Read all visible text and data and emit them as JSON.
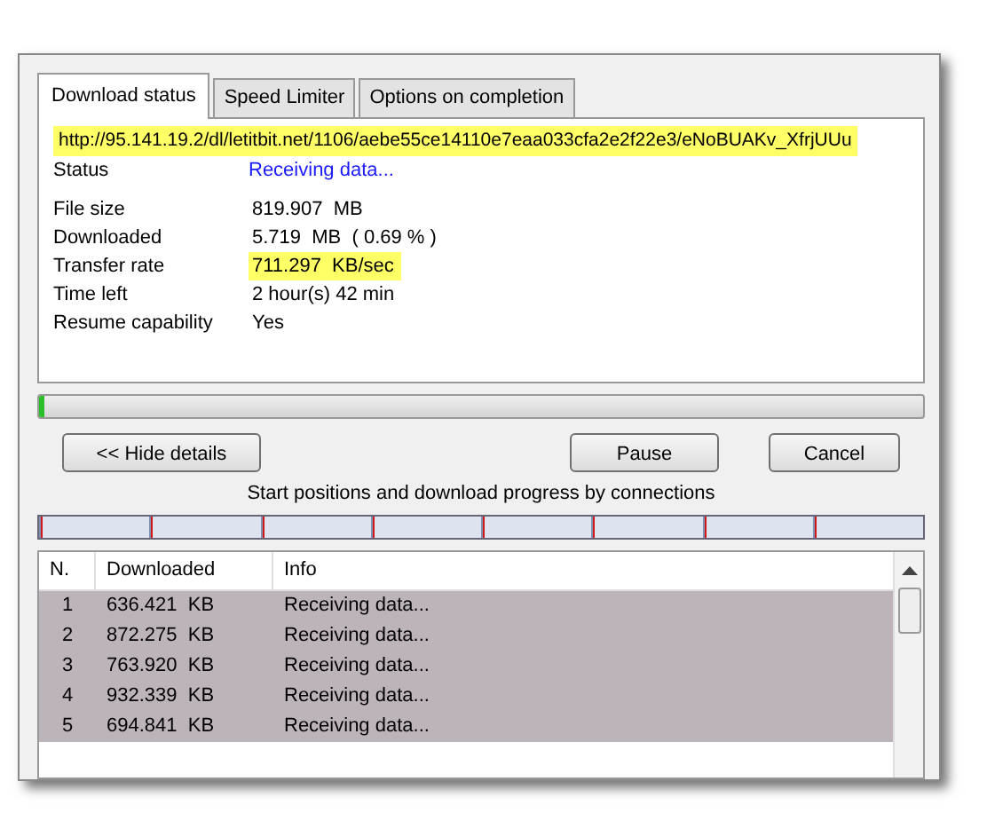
{
  "tabs": [
    {
      "label": "Download status",
      "selected": true
    },
    {
      "label": "Speed Limiter",
      "selected": false
    },
    {
      "label": "Options on completion",
      "selected": false
    }
  ],
  "url": {
    "text": "http://95.141.19.2/dl/letitbit.net/1106/aebe55ce14110e7eaa033cfa2e2f22e3/eNoBUAKv_XfrjUUu",
    "highlighted": true
  },
  "status": {
    "label": "Status",
    "value": "Receiving data..."
  },
  "details": [
    {
      "label": "File size",
      "value": "819.907  MB",
      "highlighted": false
    },
    {
      "label": "Downloaded",
      "value": "5.719  MB  ( 0.69 % )",
      "highlighted": false
    },
    {
      "label": "Transfer rate",
      "value": "711.297  KB/sec",
      "highlighted": true
    },
    {
      "label": "Time left",
      "value": "2 hour(s) 42 min",
      "highlighted": false
    },
    {
      "label": "Resume capability",
      "value": "Yes",
      "highlighted": false
    }
  ],
  "progress": {
    "level": 0.007
  },
  "buttons": [
    "<< Hide details",
    "Pause",
    "Cancel"
  ],
  "connections_label": "Start positions and download progress by connections",
  "connection_segments": [
    {
      "level": 0.01
    },
    {
      "level": 0.01
    },
    {
      "level": 0.01
    },
    {
      "level": 0.01
    },
    {
      "level": 0.01
    },
    {
      "level": 0.01
    },
    {
      "level": 0.01
    },
    {
      "level": 0.01
    }
  ],
  "table": {
    "columns": [
      "N.",
      "Downloaded",
      "Info"
    ],
    "rows": [
      {
        "n": "1",
        "downloaded": "636.421  KB",
        "info": "Receiving data..."
      },
      {
        "n": "2",
        "downloaded": "872.275  KB",
        "info": "Receiving data..."
      },
      {
        "n": "3",
        "downloaded": "763.920  KB",
        "info": "Receiving data..."
      },
      {
        "n": "4",
        "downloaded": "932.339  KB",
        "info": "Receiving data..."
      },
      {
        "n": "5",
        "downloaded": "694.841  KB",
        "info": "Receiving data..."
      }
    ]
  }
}
